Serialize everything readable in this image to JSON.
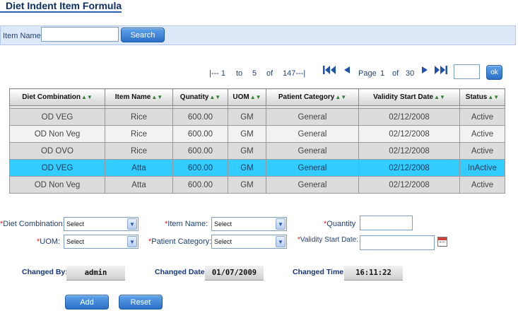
{
  "title": "Diet Indent Item Formula",
  "search": {
    "label": "Item Name:",
    "value": "",
    "button": "Search"
  },
  "pager": {
    "range_start_label": "|--- 1",
    "to": "to",
    "range_end": "5",
    "of": "of",
    "total": "147---|",
    "page_label": "Page",
    "page_current": "1",
    "page_of": "of",
    "page_total": "30",
    "page_input": "",
    "ok": "ok",
    "icons": [
      "first-page-icon",
      "prev-page-icon",
      "next-page-icon",
      "last-page-icon"
    ]
  },
  "grid": {
    "sort_icon": "▲▼",
    "columns": [
      "Diet Combination",
      "Item Name",
      "Qunatity",
      "UOM",
      "Patient Category",
      "Validity Start Date",
      "Status"
    ],
    "rows": [
      [
        "OD VEG",
        "Rice",
        "600.00",
        "GM",
        "General",
        "02/12/2008",
        "Active"
      ],
      [
        "OD Non Veg",
        "Rice",
        "600.00",
        "GM",
        "General",
        "02/12/2008",
        "Active"
      ],
      [
        "OD OVO",
        "Rice",
        "600.00",
        "GM",
        "General",
        "02/12/2008",
        "Active"
      ],
      [
        "OD VEG",
        "Atta",
        "600.00",
        "GM",
        "General",
        "02/12/2008",
        "InActive"
      ],
      [
        "OD Non Veg",
        "Atta",
        "600.00",
        "GM",
        "General",
        "02/12/2008",
        "Active"
      ]
    ],
    "selected_row": 3,
    "selected_color": "#33ccff"
  },
  "form": {
    "required_mark": "*",
    "diet_combination": {
      "label": "Diet Combination:",
      "value": "Select"
    },
    "item_name": {
      "label": "Item Name:",
      "value": "Select"
    },
    "quantity": {
      "label": "Quantity",
      "value": ""
    },
    "uom": {
      "label": "UOM:",
      "value": "Select"
    },
    "patient_category": {
      "label": "Patient Category:",
      "value": "Select"
    },
    "validity_start_date": {
      "label": "Validity Start Date:",
      "value": ""
    }
  },
  "audit": {
    "changed_by_label": "Changed By:",
    "changed_by": "admin",
    "changed_date_label": "Changed Date:",
    "changed_date": "01/07/2009",
    "changed_time_label": "Changed Time:",
    "changed_time": "16:11:22"
  },
  "actions": {
    "add": "Add",
    "reset": "Reset"
  },
  "colors": {
    "accent": "#2c6fc7",
    "title": "#0d2f63",
    "required": "#d02020"
  }
}
